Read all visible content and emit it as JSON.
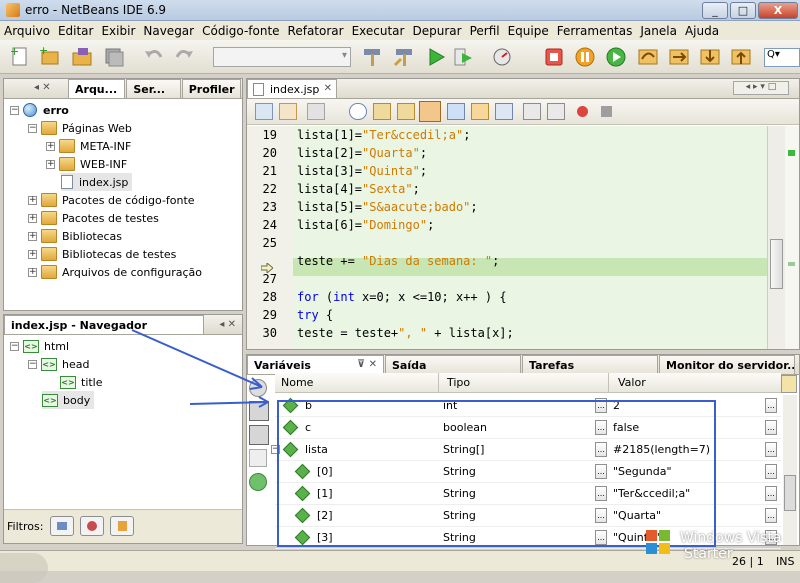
{
  "window": {
    "title": "erro - NetBeans IDE 6.9",
    "btn_min": "_",
    "btn_max": "□",
    "btn_close": "X"
  },
  "menu": [
    "Arquivo",
    "Editar",
    "Exibir",
    "Navegar",
    "Código-fonte",
    "Refatorar",
    "Executar",
    "Depurar",
    "Perfil",
    "Equipe",
    "Ferramentas",
    "Janela",
    "Ajuda"
  ],
  "toolbar": {
    "search_placeholder": "Q▾"
  },
  "projects": {
    "tabs": [
      "Arqu...",
      "Ser...",
      "Profiler"
    ],
    "tree": [
      {
        "label": "erro",
        "bold": true
      },
      {
        "label": "Páginas Web"
      },
      {
        "label": "META-INF"
      },
      {
        "label": "WEB-INF"
      },
      {
        "label": "index.jsp"
      },
      {
        "label": "Pacotes de código-fonte"
      },
      {
        "label": "Pacotes de testes"
      },
      {
        "label": "Bibliotecas"
      },
      {
        "label": "Bibliotecas de testes"
      },
      {
        "label": "Arquivos de configuração"
      }
    ]
  },
  "navigator": {
    "title": "index.jsp - Navegador",
    "tree": [
      "html",
      "head",
      "title",
      "body"
    ],
    "filters_label": "Filtros:"
  },
  "editor": {
    "tab": "index.jsp",
    "lines": [
      {
        "num": "19",
        "text": "lista[1]=\"Ter&ccedil;a\";"
      },
      {
        "num": "20",
        "text": "lista[2]=\"Quarta\";"
      },
      {
        "num": "21",
        "text": "lista[3]=\"Quinta\";"
      },
      {
        "num": "22",
        "text": "lista[4]=\"Sexta\";"
      },
      {
        "num": "23",
        "text": "lista[5]=\"S&aacute;bado\";"
      },
      {
        "num": "24",
        "text": "lista[6]=\"Domingo\";"
      },
      {
        "num": "25",
        "text": ""
      },
      {
        "num": "",
        "text": "teste += \"Dias da semana: \";"
      },
      {
        "num": "27",
        "text": ""
      },
      {
        "num": "28",
        "text": "for (int x=0; x <=10; x++ ) {"
      },
      {
        "num": "29",
        "text": "try {"
      },
      {
        "num": "30",
        "text": "teste = teste+\", \" + lista[x];"
      }
    ]
  },
  "debug": {
    "tabs": [
      "Variáveis",
      "Saída",
      "Tarefas",
      "Monitor do servidor..."
    ],
    "columns": {
      "name": "Nome",
      "type": "Tipo",
      "value": "Valor"
    },
    "rows": [
      {
        "name": "b",
        "type": "int",
        "value": "2"
      },
      {
        "name": "c",
        "type": "boolean",
        "value": "false"
      },
      {
        "name": "lista",
        "type": "String[]",
        "value": "#2185(length=7)"
      },
      {
        "name": "[0]",
        "type": "String",
        "value": "\"Segunda\""
      },
      {
        "name": "[1]",
        "type": "String",
        "value": "\"Ter&ccedil;a\""
      },
      {
        "name": "[2]",
        "type": "String",
        "value": "\"Quarta\""
      },
      {
        "name": "[3]",
        "type": "String",
        "value": "\"Quinta\""
      }
    ]
  },
  "status": {
    "position": "26 | 1",
    "mode": "INS"
  },
  "watermark": {
    "line1": "Windows Vista",
    "line2": "Starter"
  },
  "colors": {
    "annotation_blue": "#3a5fcd",
    "highlight_line": "#c8e6b4",
    "editor_bg": "#e9f5e3"
  }
}
